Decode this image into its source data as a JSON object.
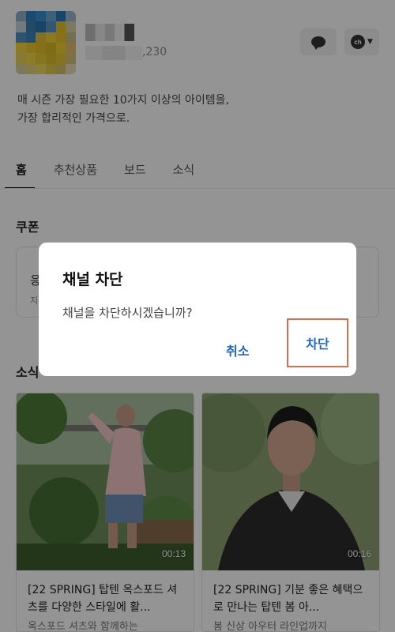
{
  "profile": {
    "friend_count_suffix": ",230"
  },
  "header_buttons": {
    "chat_icon": "chat-bubble-icon",
    "channel_badge": "ch"
  },
  "description": {
    "line1": "매 시즌 가장 필요한 10가지 이상의 아이템을,",
    "line2": "가장 합리적인 가격으로."
  },
  "tabs": [
    {
      "label": "홈",
      "active": true
    },
    {
      "label": "추천상품",
      "active": false
    },
    {
      "label": "보드",
      "active": false
    },
    {
      "label": "소식",
      "active": false
    }
  ],
  "sections": {
    "coupon_title": "쿠폰",
    "coupon_frag1": "응",
    "coupon_frag2": "지",
    "news_title_frag": "소식"
  },
  "cards": [
    {
      "duration": "00:13",
      "title": "[22 SPRING] 탑텐 옥스포드 셔츠를 다양한 스타일에 활...",
      "subtitle": "옥스포드 셔츠와 함께하는"
    },
    {
      "duration": "00:16",
      "title": "[22 SPRING] 기분 좋은 혜택으로 만나는 탑텐 봄 아...",
      "subtitle": "봄 신상 아우터 라인업까지"
    }
  ],
  "dialog": {
    "title": "채널 차단",
    "message": "채널을 차단하시겠습니까?",
    "cancel_label": "취소",
    "confirm_label": "차단"
  },
  "colors": {
    "accent": "#1f67c7",
    "highlight_box": "#d4704f",
    "overlay": "rgba(0,0,0,0.42)"
  }
}
